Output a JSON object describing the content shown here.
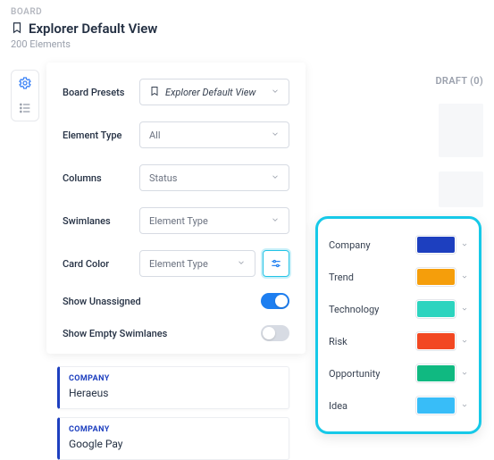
{
  "breadcrumb": "BOARD",
  "title": "Explorer Default View",
  "subtitle": "200 Elements",
  "draft_tab": "DRAFT (0)",
  "panel": {
    "presets_label": "Board Presets",
    "presets_value": "Explorer Default View",
    "element_type_label": "Element Type",
    "element_type_value": "All",
    "columns_label": "Columns",
    "columns_value": "Status",
    "swimlanes_label": "Swimlanes",
    "swimlanes_value": "Element Type",
    "card_color_label": "Card Color",
    "card_color_value": "Element Type",
    "show_unassigned_label": "Show Unassigned",
    "show_unassigned_on": true,
    "show_empty_label": "Show Empty Swimlanes",
    "show_empty_on": false
  },
  "cards": [
    {
      "badge": "COMPANY",
      "name": "Heraeus"
    },
    {
      "badge": "COMPANY",
      "name": "Google Pay"
    }
  ],
  "color_popover": [
    {
      "label": "Company",
      "color": "#1d3fbf"
    },
    {
      "label": "Trend",
      "color": "#f59e0b"
    },
    {
      "label": "Technology",
      "color": "#2dd4bf"
    },
    {
      "label": "Risk",
      "color": "#f24822"
    },
    {
      "label": "Opportunity",
      "color": "#10b981"
    },
    {
      "label": "Idea",
      "color": "#38bdf8"
    }
  ]
}
